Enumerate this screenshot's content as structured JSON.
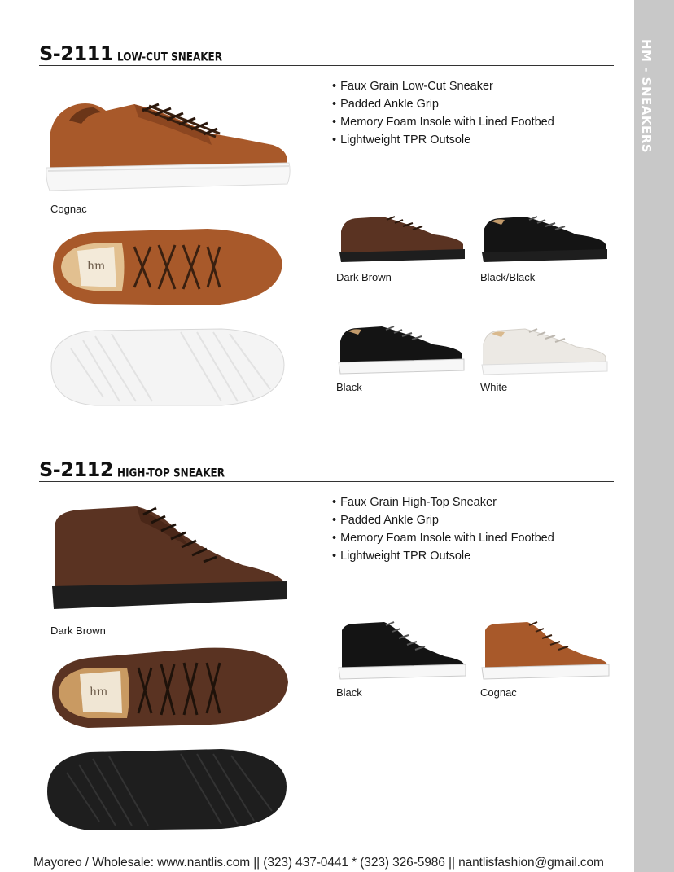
{
  "side_tab": {
    "label": "HM - SNEAKERS"
  },
  "products": [
    {
      "code": "S-2111",
      "type": "LOW-CUT SNEAKER",
      "features": [
        "Faux Grain Low-Cut Sneaker",
        "Padded Ankle Grip",
        "Memory Foam Insole with Lined Footbed",
        "Lightweight TPR Outsole"
      ],
      "main_color": "Cognac",
      "colors": [
        "Dark Brown",
        "Black/Black",
        "Black",
        "White"
      ]
    },
    {
      "code": "S-2112",
      "type": "HIGH-TOP SNEAKER",
      "features": [
        "Faux Grain High-Top Sneaker",
        "Padded Ankle Grip",
        "Memory Foam Insole with Lined Footbed",
        "Lightweight TPR Outsole"
      ],
      "main_color": "Dark Brown",
      "colors": [
        "Black",
        "Cognac"
      ]
    }
  ],
  "colors": {
    "cognac": "#a8592a",
    "dark_brown": "#5a3322",
    "black": "#141414",
    "white_leather": "#ece9e4",
    "white_sole": "#f7f7f7",
    "black_sole": "#1e1e1e",
    "side_tab": "#c8c8c8"
  },
  "footer": {
    "text": "Mayoreo / Wholesale: www.nantlis.com || (323) 437-0441 * (323) 326-5986 || nantlisfashion@gmail.com"
  }
}
